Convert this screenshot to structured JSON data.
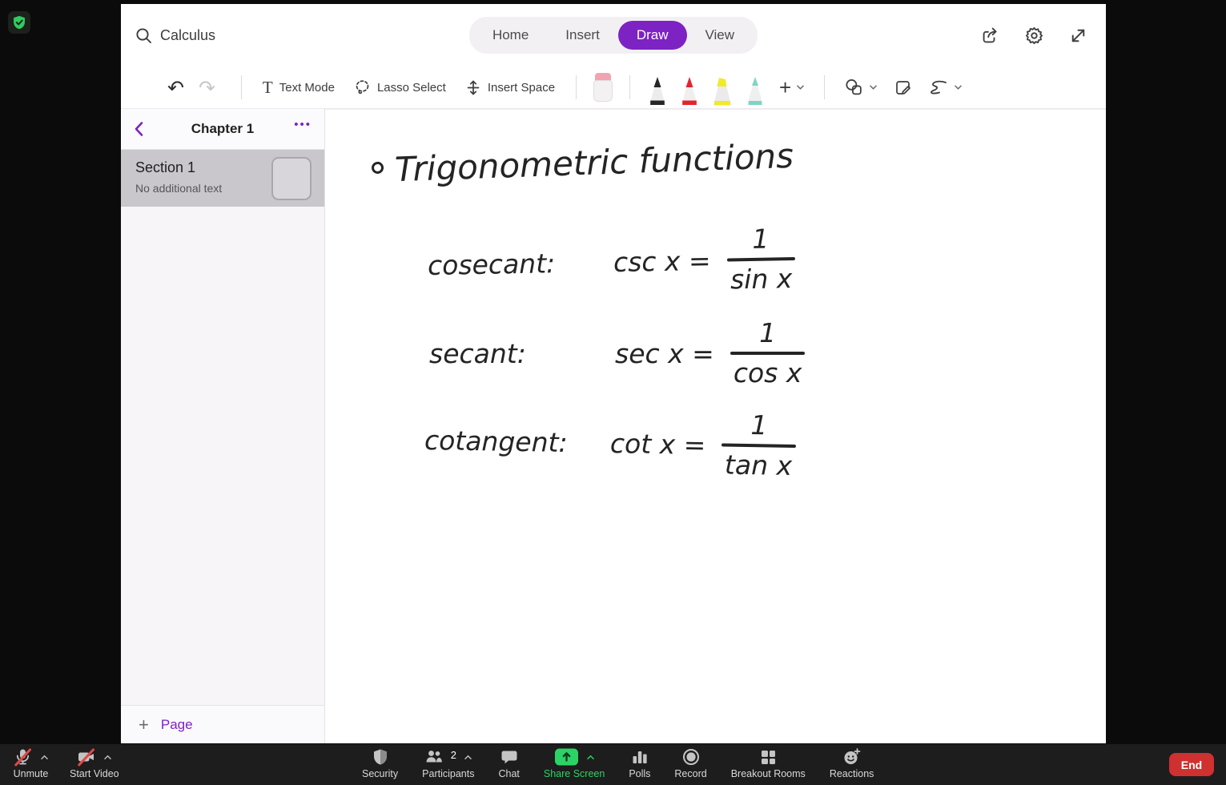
{
  "app": {
    "search": {
      "value": "Calculus"
    },
    "tabs": [
      {
        "label": "Home",
        "active": false
      },
      {
        "label": "Insert",
        "active": false
      },
      {
        "label": "Draw",
        "active": true
      },
      {
        "label": "View",
        "active": false
      }
    ],
    "accent_purple": "#7d22c3",
    "ribbon": {
      "undo_glyph": "↶",
      "redo_glyph": "↷",
      "text_mode_glyph": "T",
      "text_mode": "Text Mode",
      "lasso_select": "Lasso Select",
      "insert_space": "Insert Space",
      "add_pen_glyph": "+",
      "eraser_cap_color": "#f2a3b2",
      "pens": [
        {
          "name": "black pen",
          "color": "#262626"
        },
        {
          "name": "red pen",
          "color": "#e3242b"
        },
        {
          "name": "yellow highlighter",
          "color": "#f1ea2b"
        },
        {
          "name": "teal pen",
          "color": "#7fd4c4"
        }
      ]
    },
    "sidebar": {
      "title": "Chapter 1",
      "menu_glyph": "•••",
      "section": {
        "title": "Section 1",
        "subtitle": "No additional text"
      },
      "add_page_glyph": "+",
      "add_page_label": "Page"
    },
    "canvas": {
      "title": "Trigonometric functions",
      "formulas": [
        {
          "label": "cosecant:",
          "lhs": "csc x =",
          "numerator": "1",
          "denominator": "sin x"
        },
        {
          "label": "secant:",
          "lhs": "sec x =",
          "numerator": "1",
          "denominator": "cos x"
        },
        {
          "label": "cotangent:",
          "lhs": "cot x =",
          "numerator": "1",
          "denominator": "tan x"
        }
      ]
    }
  },
  "meeting": {
    "share_green": "#2bd366",
    "end_red": "#cf3030",
    "controls": {
      "unmute": "Unmute",
      "start_video": "Start Video",
      "security": "Security",
      "participants": "Participants",
      "participants_count": "2",
      "chat": "Chat",
      "share_screen": "Share Screen",
      "polls": "Polls",
      "record": "Record",
      "breakout_rooms": "Breakout Rooms",
      "reactions": "Reactions",
      "end": "End"
    }
  }
}
